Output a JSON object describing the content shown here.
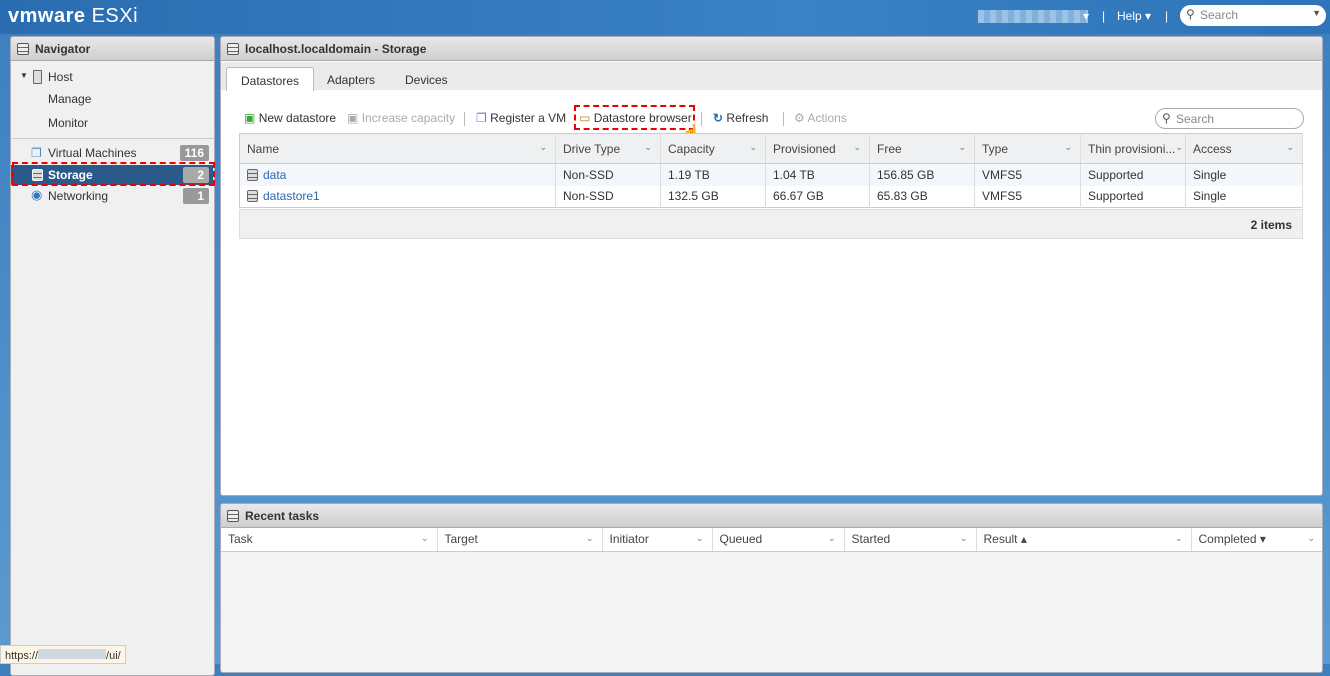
{
  "header": {
    "brand": "vmware",
    "product": "ESXi",
    "help": "Help ▾",
    "search_placeholder": "Search"
  },
  "navigator": {
    "title": "Navigator",
    "items": [
      {
        "label": "Host"
      },
      {
        "label": "Manage"
      },
      {
        "label": "Monitor"
      },
      {
        "label": "Virtual Machines",
        "count": "116"
      },
      {
        "label": "Storage",
        "count": "2"
      },
      {
        "label": "Networking",
        "count": "1"
      }
    ]
  },
  "main": {
    "title": "localhost.localdomain - Storage",
    "tabs": [
      "Datastores",
      "Adapters",
      "Devices"
    ],
    "toolbar": {
      "new": "New datastore",
      "increase": "Increase capacity",
      "register": "Register a VM",
      "browser": "Datastore browser",
      "refresh": "Refresh",
      "actions": "Actions",
      "search_placeholder": "Search"
    },
    "columns": [
      "Name",
      "Drive Type",
      "Capacity",
      "Provisioned",
      "Free",
      "Type",
      "Thin provisioni...",
      "Access"
    ],
    "rows": [
      [
        "data",
        "Non-SSD",
        "1.19 TB",
        "1.04 TB",
        "156.85 GB",
        "VMFS5",
        "Supported",
        "Single"
      ],
      [
        "datastore1",
        "Non-SSD",
        "132.5 GB",
        "66.67 GB",
        "65.83 GB",
        "VMFS5",
        "Supported",
        "Single"
      ]
    ],
    "footer": "2 items"
  },
  "tasks": {
    "title": "Recent tasks",
    "columns": [
      "Task",
      "Target",
      "Initiator",
      "Queued",
      "Started",
      "Result ▴",
      "Completed ▾"
    ]
  },
  "statusbar": {
    "url_prefix": "https://",
    "url_suffix": "/ui/"
  }
}
